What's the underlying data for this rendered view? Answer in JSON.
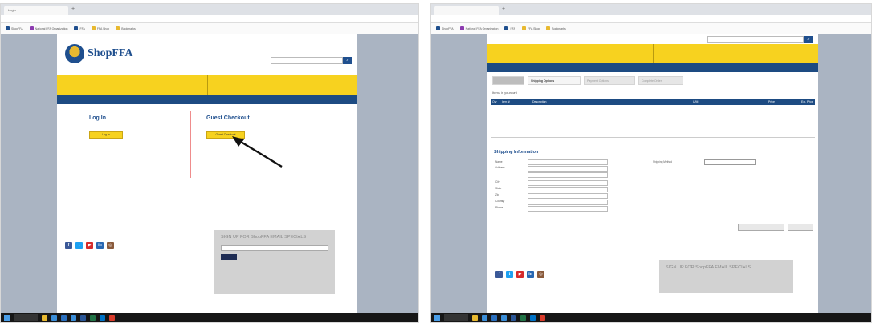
{
  "colors": {
    "ffa_blue": "#1f4f8e",
    "nav_blue": "#1d4b82",
    "ffa_yellow": "#f7d21f",
    "promo_red": "#c9423a",
    "note_red": "#d02b2b",
    "page_background": "#aab4c2",
    "taskbar": "#161616"
  },
  "left_window": {
    "tab_title": "Login",
    "address": "",
    "bookmarks": [
      {
        "label": "ShopFFA",
        "color": "#1f4f8e"
      },
      {
        "label": "National FFA Organization",
        "color": "#8c3bb0"
      },
      {
        "label": "FFA",
        "color": "#1f4f8e"
      },
      {
        "label": "FFA Shop",
        "color": "#e8b930"
      },
      {
        "label": "Bookmarks",
        "color": "#e8b930"
      }
    ],
    "site": {
      "logo_text": "ShopFFA",
      "header_promo": "",
      "header_promo_sub": "",
      "header_login": "",
      "header_phone": "",
      "header_cart": "",
      "search_placeholder": "",
      "promo_left": "",
      "promo_right": "",
      "nav_items": [],
      "login": {
        "title": "Log In",
        "button": "Log In",
        "note": ""
      },
      "guest": {
        "title": "Guest Checkout",
        "button": "Guest Checkout"
      },
      "legal": "",
      "connect": "",
      "social": [
        {
          "icon": "facebook-icon",
          "glyph": "f",
          "color": "#3b5998"
        },
        {
          "icon": "twitter-icon",
          "glyph": "t",
          "color": "#1da1f2"
        },
        {
          "icon": "youtube-icon",
          "glyph": "▶",
          "color": "#d62b2b"
        },
        {
          "icon": "linkedin-icon",
          "glyph": "in",
          "color": "#2867b2"
        },
        {
          "icon": "instagram-icon",
          "glyph": "◎",
          "color": "#8a5a3b"
        }
      ],
      "signup": {
        "title": "SIGN UP FOR ShopFFA EMAIL SPECIALS",
        "label": "",
        "placeholder": "",
        "button": ""
      }
    }
  },
  "right_window": {
    "tab_title": "",
    "address": "",
    "bookmarks": [
      {
        "label": "ShopFFA",
        "color": "#1f4f8e"
      },
      {
        "label": "National FFA Organization",
        "color": "#8c3bb0"
      },
      {
        "label": "FFA",
        "color": "#1f4f8e"
      },
      {
        "label": "FFA Shop",
        "color": "#e8b930"
      },
      {
        "label": "Bookmarks",
        "color": "#e8b930"
      }
    ],
    "site": {
      "search_placeholder": "",
      "promo_left": "",
      "promo_right": "",
      "nav_items": [],
      "steps": [
        {
          "label": "",
          "state": "done"
        },
        {
          "label": "Shipping Options",
          "state": "active"
        },
        {
          "label": "Payment Options",
          "state": "pending"
        },
        {
          "label": "Complete Order",
          "state": "pending"
        }
      ],
      "items_title": "Items in your cart",
      "table": {
        "headers": [
          "Qty",
          "Item #",
          "Description",
          "U/M",
          "Price",
          "Ext. Price"
        ],
        "rows": [
          {
            "qty": "",
            "item": "",
            "desc": "",
            "um": "",
            "price": "",
            "total": "",
            "sub": ""
          },
          {
            "qty": "",
            "item": "",
            "desc": "",
            "um": "",
            "price": "",
            "total": "",
            "sub": ""
          },
          {
            "qty": "",
            "item": "",
            "desc": "",
            "um": "",
            "price": "",
            "total": "",
            "sub": ""
          }
        ]
      },
      "subtotal_label": "",
      "subtotal_value": "",
      "shipping_title": "Shipping Information",
      "form": {
        "name_label": "Name",
        "name_value": "",
        "address_label": "Address",
        "city_label": "City",
        "state_label": "State",
        "state_placeholder": "",
        "zip_label": "Zip",
        "country_label": "Country",
        "country_placeholder": "",
        "phone_label": "Phone"
      },
      "ship_method_label": "Shipping Method",
      "ship_method_value": "",
      "ship_note": "",
      "prev_button": "",
      "next_button": "",
      "legal": "",
      "connect": "",
      "social": [
        {
          "icon": "facebook-icon",
          "glyph": "f",
          "color": "#3b5998"
        },
        {
          "icon": "twitter-icon",
          "glyph": "t",
          "color": "#1da1f2"
        },
        {
          "icon": "youtube-icon",
          "glyph": "▶",
          "color": "#d62b2b"
        },
        {
          "icon": "linkedin-icon",
          "glyph": "in",
          "color": "#2867b2"
        },
        {
          "icon": "instagram-icon",
          "glyph": "◎",
          "color": "#8a5a3b"
        }
      ],
      "signup_title": "SIGN UP FOR ShopFFA EMAIL SPECIALS"
    }
  },
  "taskbar_icons": [
    {
      "name": "file-explorer-icon",
      "color": "#e8b930"
    },
    {
      "name": "browser-icon",
      "color": "#3b8ed8"
    },
    {
      "name": "mail-icon",
      "color": "#2a6fbe"
    },
    {
      "name": "store-icon",
      "color": "#3b8ed8"
    },
    {
      "name": "word-icon",
      "color": "#2b5797"
    },
    {
      "name": "excel-icon",
      "color": "#217346"
    },
    {
      "name": "outlook-icon",
      "color": "#0072c6"
    },
    {
      "name": "chrome-icon",
      "color": "#d83b2b"
    }
  ]
}
